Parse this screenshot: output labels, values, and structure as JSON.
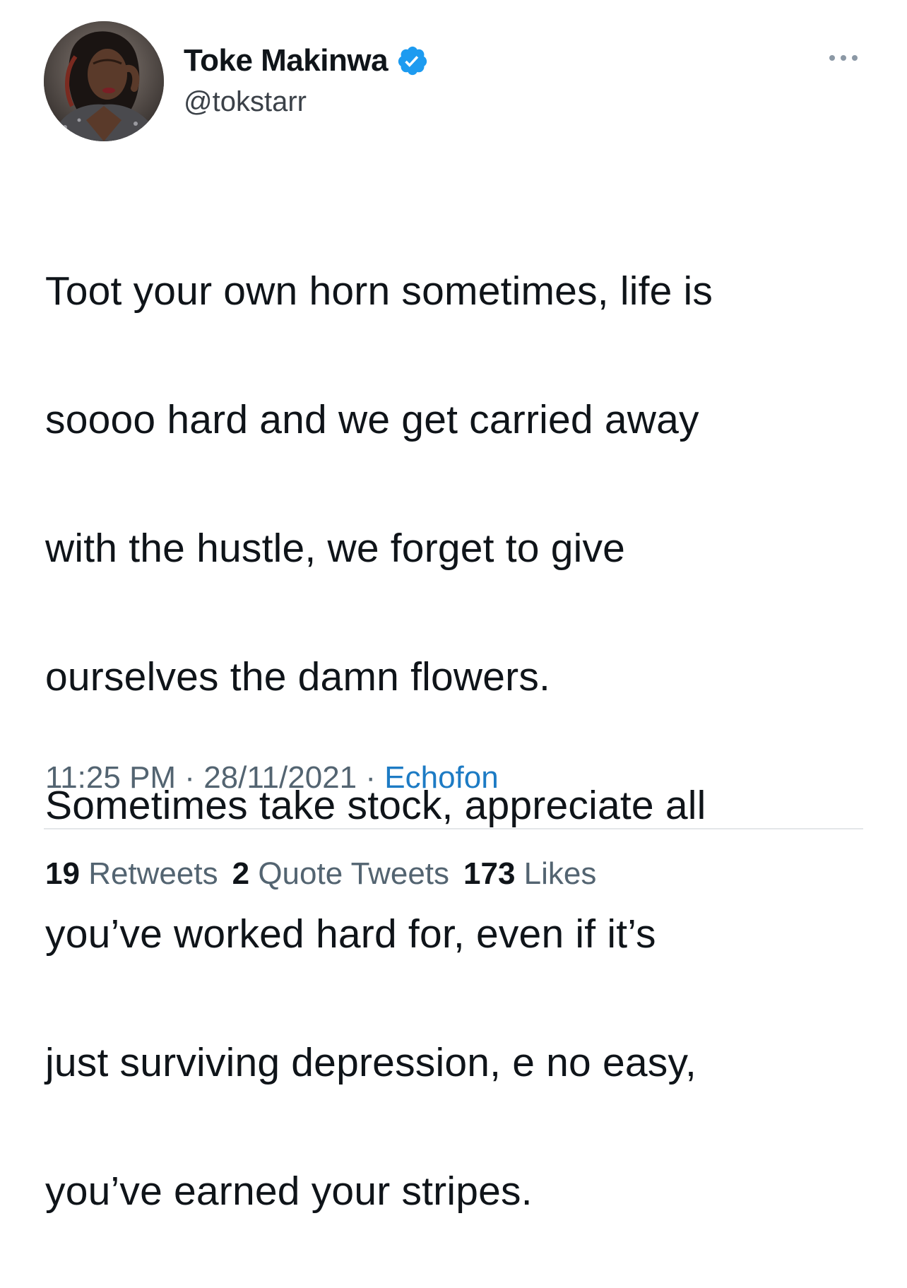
{
  "author": {
    "display_name": "Toke Makinwa",
    "handle": "@tokstarr",
    "verified_color": "#1d9bf0"
  },
  "tweet": {
    "text_lines": [
      "Toot your own horn sometimes, life is",
      "soooo hard and we get carried away",
      "with the hustle, we forget to give",
      "ourselves the damn flowers.",
      "Sometimes take stock, appreciate all",
      "you’ve worked hard for, even if it’s",
      "just surviving depression, e no easy,",
      "you’ve earned your stripes."
    ]
  },
  "meta": {
    "time": "11:25 PM",
    "separator": " · ",
    "date": "28/11/2021",
    "source": "Echofon"
  },
  "stats": {
    "retweets_count": "19",
    "retweets_label": "Retweets",
    "quotes_count": "2",
    "quotes_label": "Quote Tweets",
    "likes_count": "173",
    "likes_label": "Likes"
  },
  "icons": {
    "verified": "verified-badge-icon",
    "more": "more-options-icon"
  }
}
